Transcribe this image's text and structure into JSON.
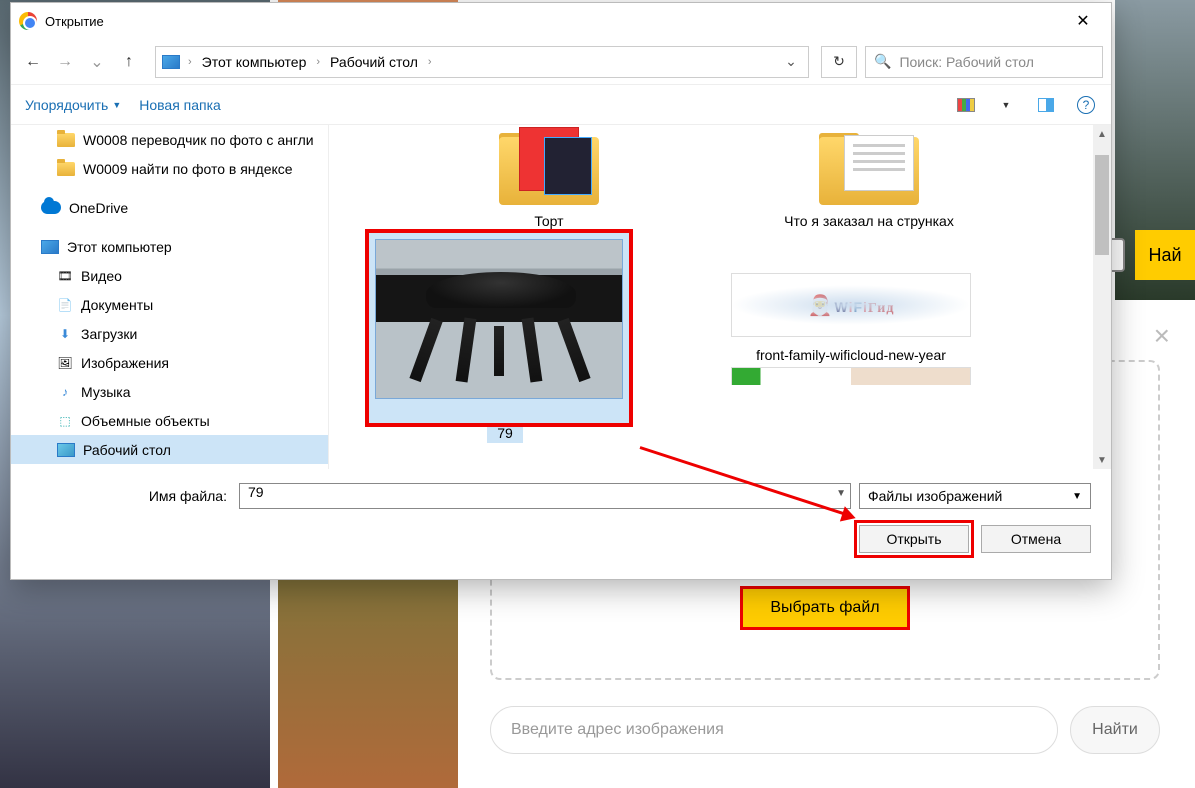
{
  "background": {
    "search_button": "Най",
    "choose_file": "Выбрать файл",
    "url_placeholder": "Введите адрес изображения",
    "find_button": "Найти",
    "close_x": "×"
  },
  "dialog": {
    "title": "Открытие",
    "close_x": "✕",
    "nav": {
      "back": "←",
      "forward": "→",
      "dropdown": "⌄",
      "up": "↑",
      "refresh": "↻"
    },
    "breadcrumb": {
      "root": "Этот компьютер",
      "folder": "Рабочий стол",
      "sep": "›",
      "dropdown": "⌄"
    },
    "search_placeholder": "Поиск: Рабочий стол",
    "toolbar": {
      "organize": "Упорядочить",
      "new_folder": "Новая папка",
      "help": "?"
    },
    "sidebar": {
      "items": [
        {
          "icon": "folder",
          "label": "W0008 переводчик по фото с англи",
          "level": 2
        },
        {
          "icon": "folder",
          "label": "W0009 найти по фото в яндексе",
          "level": 2
        },
        {
          "icon": "onedrive",
          "label": "OneDrive",
          "level": 1
        },
        {
          "icon": "pc",
          "label": "Этот компьютер",
          "level": 1
        },
        {
          "icon": "video",
          "label": "Видео",
          "level": 2
        },
        {
          "icon": "docs",
          "label": "Документы",
          "level": 2
        },
        {
          "icon": "downloads",
          "label": "Загрузки",
          "level": 2
        },
        {
          "icon": "images",
          "label": "Изображения",
          "level": 2
        },
        {
          "icon": "music",
          "label": "Музыка",
          "level": 2
        },
        {
          "icon": "3d",
          "label": "Объемные объекты",
          "level": 2
        },
        {
          "icon": "desktop",
          "label": "Рабочий стол",
          "level": 2,
          "selected": true
        }
      ]
    },
    "files": {
      "row1": [
        {
          "name": "Торт",
          "type": "folder-media"
        },
        {
          "name": "Что я заказал на струнках",
          "type": "folder-docs"
        }
      ],
      "row2": [
        {
          "name": "79",
          "type": "image-router",
          "selected": true
        },
        {
          "name": "front-family-wificloud-new-year",
          "type": "image-wifi"
        }
      ]
    },
    "footer": {
      "filename_label": "Имя файла:",
      "filename_value": "79",
      "filter": "Файлы изображений",
      "open_btn": "Открыть",
      "cancel_btn": "Отмена"
    }
  }
}
